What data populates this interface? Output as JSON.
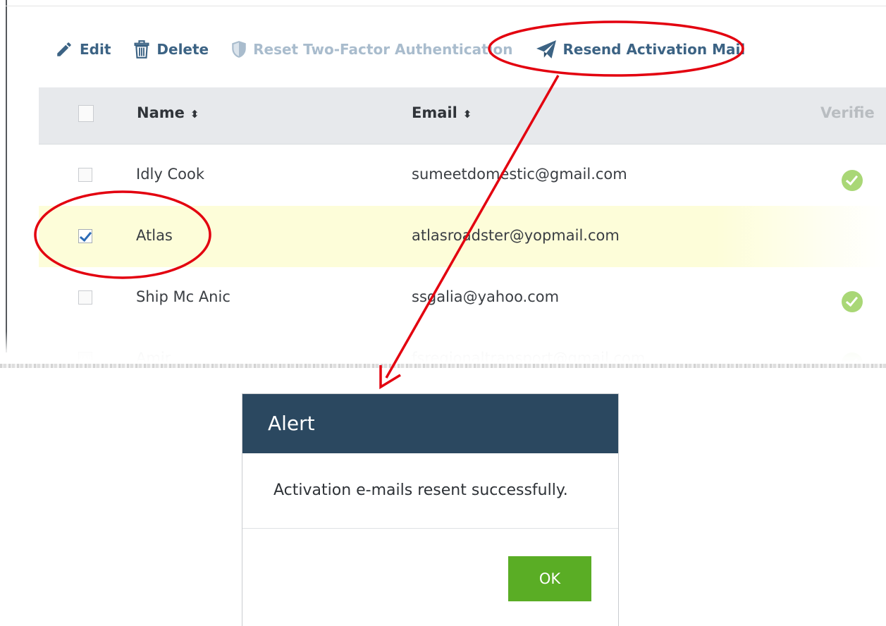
{
  "toolbar": {
    "edit_label": "Edit",
    "delete_label": "Delete",
    "reset_2fa_label": "Reset Two-Factor Authentication",
    "resend_label": "Resend Activation Mail"
  },
  "table": {
    "columns": {
      "name": "Name",
      "email": "Email",
      "verified": "Verifie"
    },
    "sort_glyph": "⬍",
    "rows": [
      {
        "name": "Idly Cook",
        "email": "sumeetdomestic@gmail.com",
        "checked": false,
        "verified": true
      },
      {
        "name": "Atlas",
        "email": "atlasroadster@yopmail.com",
        "checked": true,
        "verified": false
      },
      {
        "name": "Ship Mc Anic",
        "email": "ssgalia@yahoo.com",
        "checked": false,
        "verified": true
      },
      {
        "name": "Amir",
        "email": "fsregionaltransport@gmail.com",
        "checked": false,
        "verified": true
      }
    ]
  },
  "alert": {
    "title": "Alert",
    "message": "Activation e-mails resent successfully.",
    "ok_label": "OK"
  },
  "colors": {
    "link": "#3c6384",
    "header_bg": "#2b4860",
    "ok_green": "#5aad25",
    "annotation_red": "#e3000f",
    "selected_row": "#fdfdd9"
  }
}
